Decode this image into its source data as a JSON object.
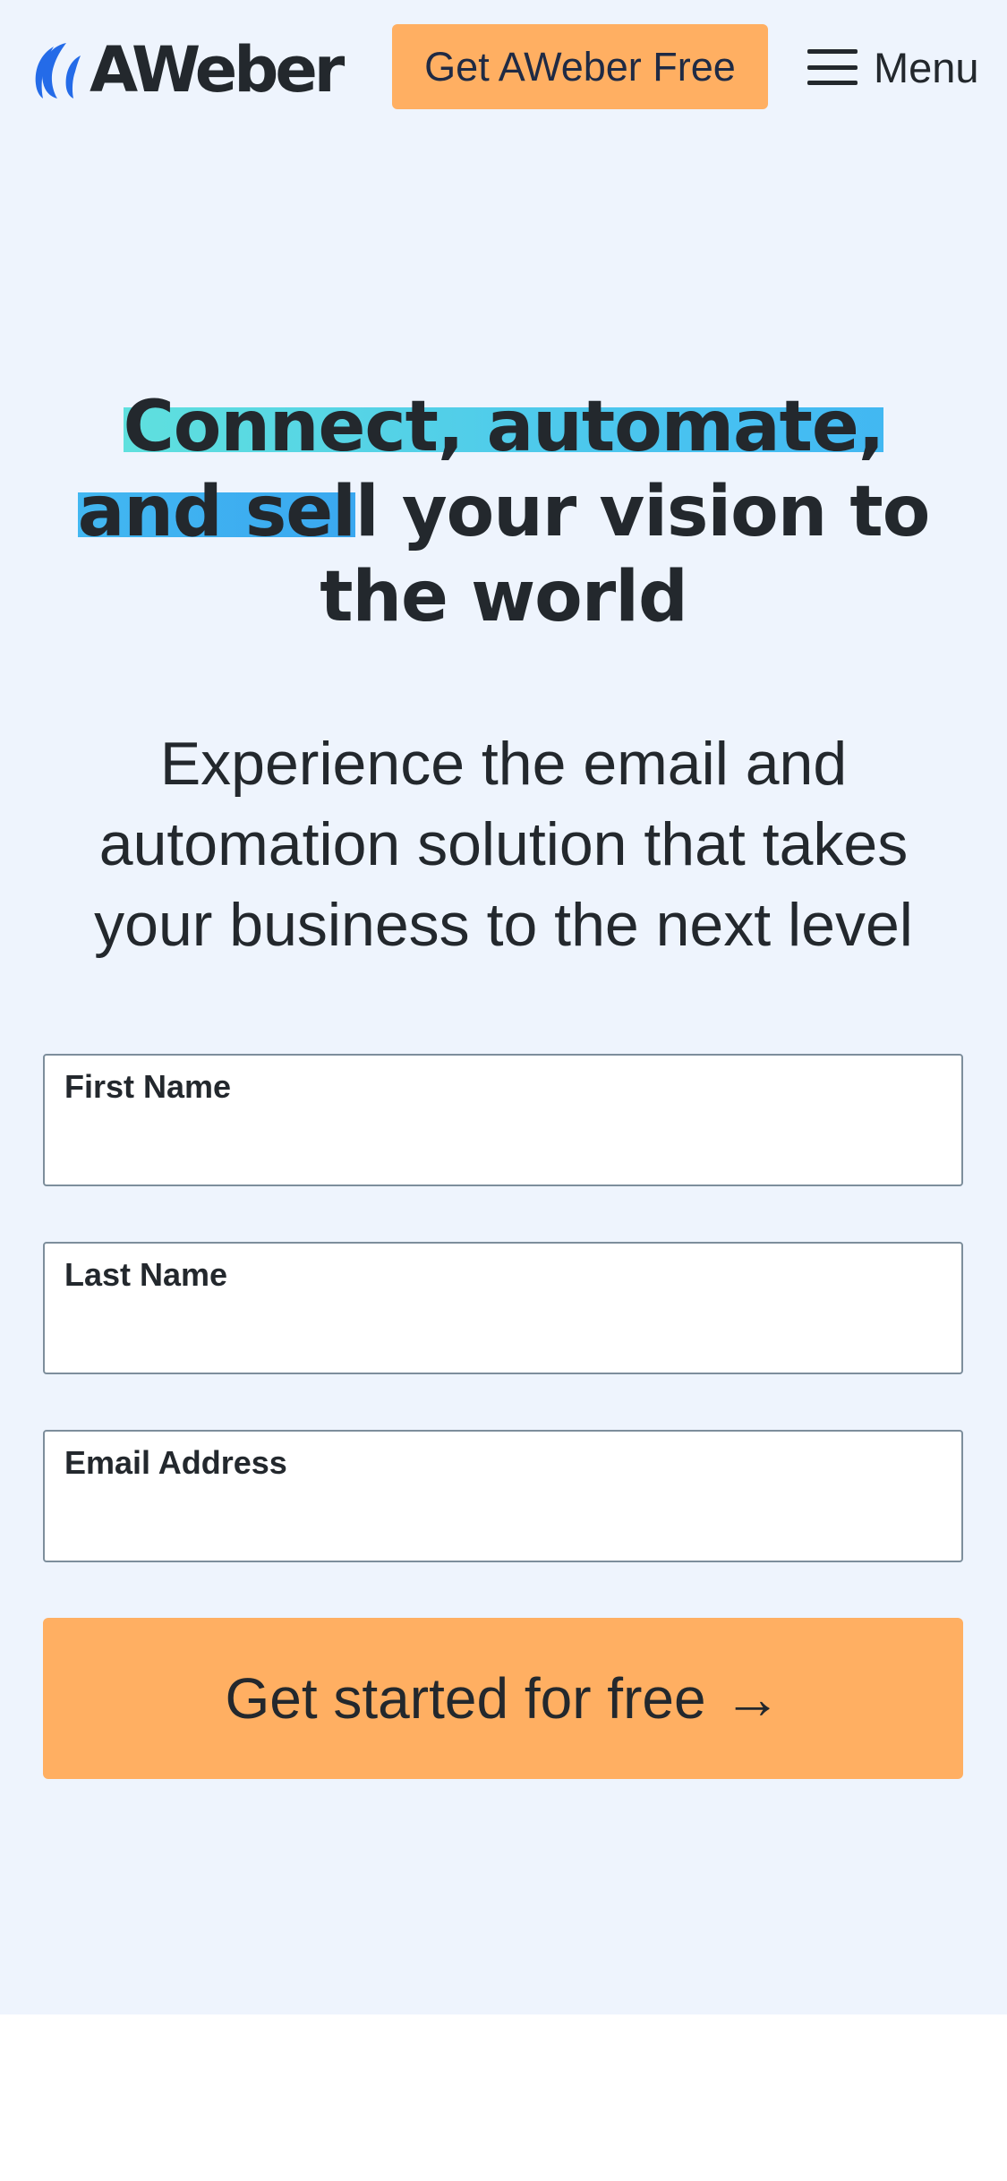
{
  "header": {
    "logo_text": "AWeber",
    "cta_label": "Get AWeber Free",
    "menu_label": "Menu",
    "menu_icon": "hamburger-icon"
  },
  "hero": {
    "headline_highlight": "Connect, automate, and sel",
    "headline_rest": "l your vision to the world",
    "subheadline": "Experience the email and automation solution that takes your business to the next level"
  },
  "form": {
    "first_name_label": "First Name",
    "last_name_label": "Last Name",
    "email_label": "Email Address",
    "submit_label": "Get started for free",
    "submit_icon": "arrow-right-icon"
  },
  "colors": {
    "page_background": "#eef4fd",
    "cta": "#ffaf62",
    "highlight_start": "#5fe0de",
    "highlight_end": "#3aa8f0",
    "logo_blue": "#246be8",
    "text": "#23282d"
  }
}
